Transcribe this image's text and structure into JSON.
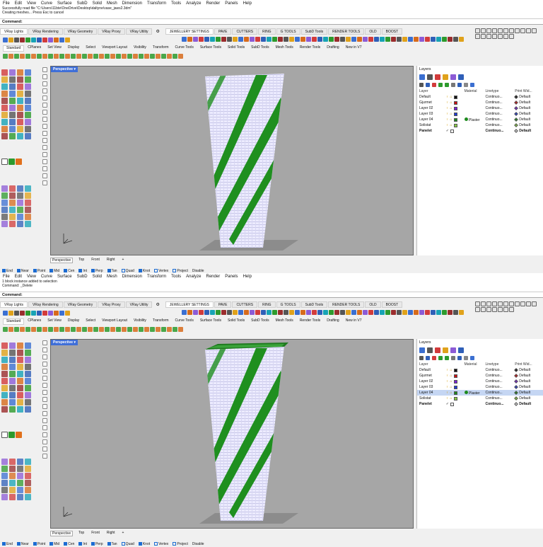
{
  "menu": [
    "File",
    "Edit",
    "View",
    "Curve",
    "Surface",
    "SubD",
    "Solid",
    "Mesh",
    "Dimension",
    "Transform",
    "Tools",
    "Analyze",
    "Render",
    "Panels",
    "Help"
  ],
  "windows": [
    {
      "history": [
        "Successfully read file \"C:\\Users\\11bte\\OneDrive\\Desktop\\daltyne\\vase_jaws2.3dm\"",
        "Creating meshes... Press Esc to cancel"
      ],
      "command_label": "Command:"
    },
    {
      "history": [
        "1 block instance added to selection",
        "Command: _Delete"
      ],
      "command_label": "Command:"
    }
  ],
  "toolbar_tabs": [
    "VRay Lights",
    "VRay Rendering",
    "VRay Geometry",
    "VRay Proxy",
    "VRay Utility"
  ],
  "plugin_tabs": [
    "JEWELLERY SETTINGS",
    "PAVE",
    "CUTTERS",
    "RING",
    "G TOOLS",
    "SubD Tools",
    "RENDER TOOLS",
    "OLD",
    "BOOST"
  ],
  "tool_tabs": [
    "Standard",
    "CPlanes",
    "Set View",
    "Display",
    "Select",
    "Viewport Layout",
    "Visibility",
    "Transform",
    "Curve Tools",
    "Surface Tools",
    "Solid Tools",
    "SubD Tools",
    "Mesh Tools",
    "Render Tools",
    "Drafting",
    "New in V7"
  ],
  "viewport": {
    "title": "Perspective",
    "tabs": [
      "Perspective",
      "Top",
      "Front",
      "Right"
    ],
    "axis_x": "x",
    "axis_y": "y",
    "axis_z": "z"
  },
  "snaps": [
    {
      "label": "End",
      "on": true
    },
    {
      "label": "Near",
      "on": true
    },
    {
      "label": "Point",
      "on": true
    },
    {
      "label": "Mid",
      "on": true
    },
    {
      "label": "Cen",
      "on": true
    },
    {
      "label": "Int",
      "on": true
    },
    {
      "label": "Perp",
      "on": true
    },
    {
      "label": "Tan",
      "on": true
    },
    {
      "label": "Quad",
      "on": false
    },
    {
      "label": "Knot",
      "on": true
    },
    {
      "label": "Vertex",
      "on": false
    },
    {
      "label": "Project",
      "on": false
    },
    {
      "label": "Disable",
      "on": false
    }
  ],
  "layers": {
    "panel_title": "Layers",
    "headers": {
      "layer": "Layer",
      "material": "Material",
      "linetype": "Linetype",
      "print_width": "Print Wid..."
    },
    "rows": [
      {
        "name": "Default",
        "color": "#111111",
        "material": "",
        "linetype": "Continuo...",
        "pw_color": "#111111",
        "print_width": "Default"
      },
      {
        "name": "Gjurmet",
        "color": "#cc1111",
        "material": "",
        "linetype": "Continuo...",
        "pw_color": "#cc1111",
        "print_width": "Default"
      },
      {
        "name": "Layer 02",
        "color": "#7a1fd6",
        "material": "",
        "linetype": "Continuo...",
        "pw_color": "#7a1fd6",
        "print_width": "Default"
      },
      {
        "name": "Layer 03",
        "color": "#1f3ad6",
        "material": "",
        "linetype": "Continuo...",
        "pw_color": "#1f3ad6",
        "print_width": "Default"
      },
      {
        "name": "Layer 04",
        "color": "#1c8a1c",
        "material": "Plaster",
        "linetype": "Continuo...",
        "pw_color": "#1c8a1c",
        "print_width": "Default"
      },
      {
        "name": "Solistat",
        "color": "#88cc44",
        "material": "",
        "linetype": "Continuo...",
        "pw_color": "#88cc44",
        "print_width": "Default"
      },
      {
        "name": "Panelet",
        "color": "#ffffff",
        "material": "",
        "linetype": "Continuo...",
        "pw_color": "#dddddd",
        "print_width": "Default"
      }
    ],
    "current_layer": "Panelet",
    "current_mark": "✓"
  },
  "colors": {
    "viewport_bg": "#a6a6a6",
    "viewport_title": "#3f6fd8",
    "vase_white": "#ecebff",
    "vase_green": "#1f8f1f",
    "shadow": "#8c8c8c"
  }
}
